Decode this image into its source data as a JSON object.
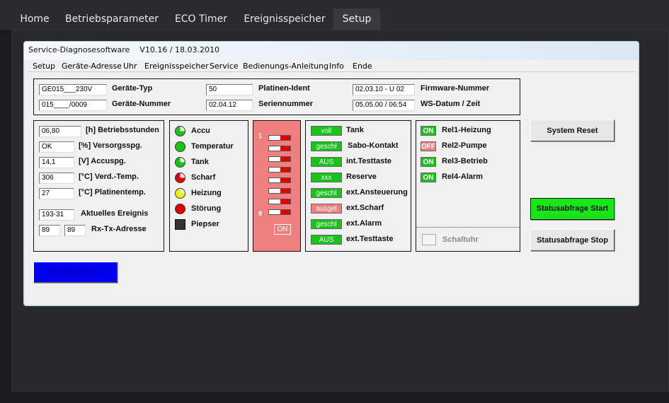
{
  "nav": {
    "tabs": [
      {
        "label": "Home"
      },
      {
        "label": "Betriebsparameter"
      },
      {
        "label": "ECO Timer"
      },
      {
        "label": "Ereignisspeicher"
      },
      {
        "label": "Setup"
      }
    ],
    "active": "Setup"
  },
  "window": {
    "title": "Service-Diagnosesoftware    V10.16 / 18.03.2010",
    "menu": [
      "Setup",
      "Geräte-Adresse",
      "Uhr",
      "Ereignisspeicher",
      "Service",
      "Bedienungs-Anleitung",
      "Info",
      "Ende"
    ]
  },
  "device": {
    "typ_value": "GE015___230V",
    "typ_label": "Geräte-Typ",
    "nummer_value": "015____/0009",
    "nummer_label": "Geräte-Nummer",
    "platinen_value": "50",
    "platinen_label": "Platinen-Ident",
    "serien_value": "02.04.12",
    "serien_label": "Seriennummer",
    "firmware_value": "02.03.10 - U 02",
    "firmware_label": "Firmware-Nummer",
    "ws_value": "05.05.00 / 06:54",
    "ws_label": "WS-Datum / Zeit"
  },
  "measures": [
    {
      "value": "06,80",
      "label": "[h] Betriebsstunden"
    },
    {
      "value": "OK",
      "label": "[%] Versorgsspg."
    },
    {
      "value": "14,1",
      "label": "[V] Accuspg."
    },
    {
      "value": "306",
      "label": "[°C] Verd.-Temp."
    },
    {
      "value": "27",
      "label": "[°C] Platinentemp."
    }
  ],
  "event": {
    "value": "193-31",
    "label": "Aktuelles Ereignis"
  },
  "rxtx": {
    "rx": "89",
    "tx": "89",
    "label": "Rx-Tx-Adresse"
  },
  "leds": [
    {
      "label": "Accu",
      "color": "#19c319",
      "icon": "accu-partial-icon"
    },
    {
      "label": "Temperatur",
      "color": "#19c319",
      "icon": "temperatur-led-icon"
    },
    {
      "label": "Tank",
      "color": "#19c319",
      "icon": "tank-partial-icon"
    },
    {
      "label": "Scharf",
      "color": "#e00000",
      "icon": "scharf-partial-icon"
    },
    {
      "label": "Heizung",
      "color": "#f0f000",
      "icon": "heizung-partial-icon"
    },
    {
      "label": "Störung",
      "color": "#e00000",
      "icon": "stoerung-led-icon"
    },
    {
      "label": "Piepser",
      "color": "#333333",
      "icon": "piepser-square-icon"
    }
  ],
  "dip": {
    "first": "1",
    "last": "8",
    "on_label": "ON",
    "background": "#f08080"
  },
  "inputs": [
    {
      "status": "voll",
      "label": "Tank",
      "color": "#19c319"
    },
    {
      "status": "geschl",
      "label": "Sabo-Kontakt",
      "color": "#19c319"
    },
    {
      "status": "AUS",
      "label": "int.Testtaste",
      "color": "#19c319"
    },
    {
      "status": "xxx",
      "label": "Reserve",
      "color": "#19c319"
    },
    {
      "status": "geschl",
      "label": "ext.Ansteuerung",
      "color": "#19c319"
    },
    {
      "status": "ausgel",
      "label": "ext.Scharf",
      "color": "#f08080"
    },
    {
      "status": "geschl",
      "label": "ext.Alarm",
      "color": "#19c319"
    },
    {
      "status": "AUS",
      "label": "ext.Testtaste",
      "color": "#19c319"
    }
  ],
  "relays": [
    {
      "state": "ON",
      "label": "Rel1-Heizung",
      "color": "#19c319"
    },
    {
      "state": "OFF",
      "label": "Rel2-Pumpe",
      "color": "#f08080"
    },
    {
      "state": "ON",
      "label": "Rel3-Betrieb",
      "color": "#19c319"
    },
    {
      "state": "ON",
      "label": "Rel4-Alarm",
      "color": "#19c319"
    }
  ],
  "schaltuhr_label": "Schaltuhr",
  "buttons": {
    "system_reset": "System Reset",
    "status_start": "Statusabfrage Start",
    "status_stop": "Statusabfrage Stop",
    "direkt_hilfe": "Direkt-Hilfe ?"
  }
}
